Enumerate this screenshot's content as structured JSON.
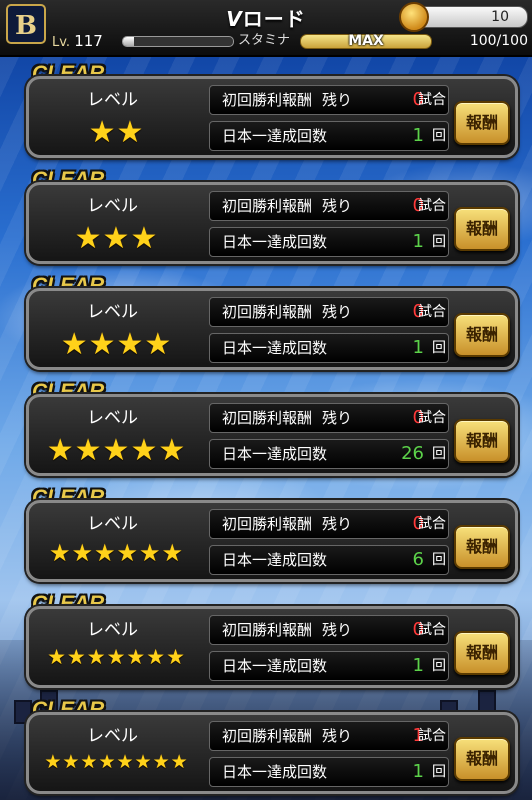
{
  "header": {
    "logo_letter": "B",
    "title_v": "V",
    "title_rest": "ロード",
    "currency_value": "10",
    "level_prefix": "Lv.",
    "level_value": "117",
    "exp_progress": 0.1,
    "stamina_label": "スタミナ",
    "stamina_status": "MAX",
    "stamina_value": "100/100"
  },
  "common": {
    "clear_label": "CLEAR",
    "level_label": "レベル",
    "first_reward_label": "初回勝利報酬",
    "remaining_label": "残り",
    "games_unit": "試合",
    "championship_label": "日本一達成回数",
    "times_unit": "回",
    "reward_button": "報酬",
    "star_glyph": "★"
  },
  "levels": [
    {
      "stars": 2,
      "remaining": "0",
      "championships": "1",
      "champ_color": "green"
    },
    {
      "stars": 3,
      "remaining": "0",
      "championships": "1",
      "champ_color": "green"
    },
    {
      "stars": 4,
      "remaining": "0",
      "championships": "1",
      "champ_color": "green"
    },
    {
      "stars": 5,
      "remaining": "0",
      "championships": "26",
      "champ_color": "green"
    },
    {
      "stars": 6,
      "remaining": "0",
      "championships": "6",
      "champ_color": "green"
    },
    {
      "stars": 7,
      "remaining": "0",
      "championships": "1",
      "champ_color": "green"
    },
    {
      "stars": 8,
      "remaining": "1",
      "championships": "1",
      "champ_color": "green"
    }
  ],
  "colors": {
    "remaining": "#ff3a3a",
    "championships": "#5cd24a",
    "clear": "#e8c84a"
  }
}
